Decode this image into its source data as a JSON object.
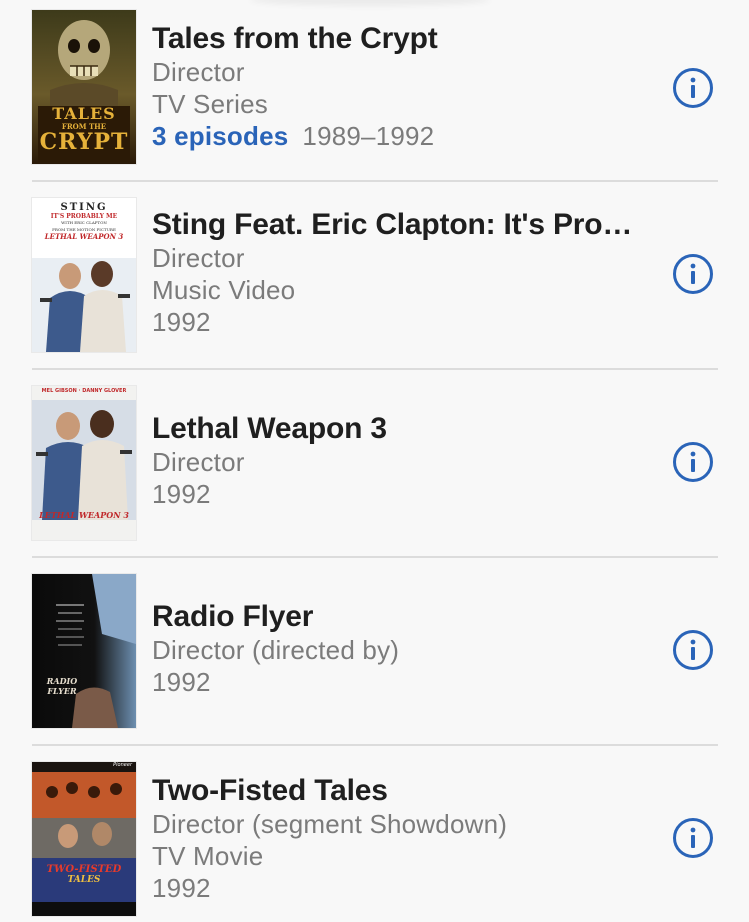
{
  "colors": {
    "accent": "#2a64b8",
    "title": "#1f1f1f",
    "secondary": "#7b7b7b",
    "divider": "#dcdcdc"
  },
  "credits": [
    {
      "title": "Tales from the Crypt",
      "role": "Director",
      "type": "TV Series",
      "episodes": "3 episodes",
      "years": "1989–1992",
      "poster_text": [
        "TALES",
        "FROM THE",
        "CRYPT"
      ],
      "info_icon": "info-circle-icon"
    },
    {
      "title": "Sting Feat. Eric Clapton: It's Pro…",
      "role": "Director",
      "type": "Music Video",
      "years": "1992",
      "poster_text": [
        "STING",
        "IT'S PROBABLY ME",
        "WITH ERIC CLAPTON",
        "FROM THE MOTION PICTURE",
        "LETHAL WEAPON 3"
      ],
      "info_icon": "info-circle-icon"
    },
    {
      "title": "Lethal Weapon 3",
      "role": "Director",
      "years": "1992",
      "poster_text": [
        "MEL GIBSON",
        "DANNY GLOVER",
        "LETHAL WEAPON 3"
      ],
      "info_icon": "info-circle-icon"
    },
    {
      "title": "Radio Flyer",
      "role": "Director (directed by)",
      "years": "1992",
      "poster_text": [
        "RADIO FLYER"
      ],
      "info_icon": "info-circle-icon"
    },
    {
      "title": "Two-Fisted Tales",
      "role": "Director (segment Showdown)",
      "type": "TV Movie",
      "years": "1992",
      "poster_text": [
        "Pioneer",
        "TWO-FISTED",
        "TALES"
      ],
      "info_icon": "info-circle-icon"
    }
  ]
}
